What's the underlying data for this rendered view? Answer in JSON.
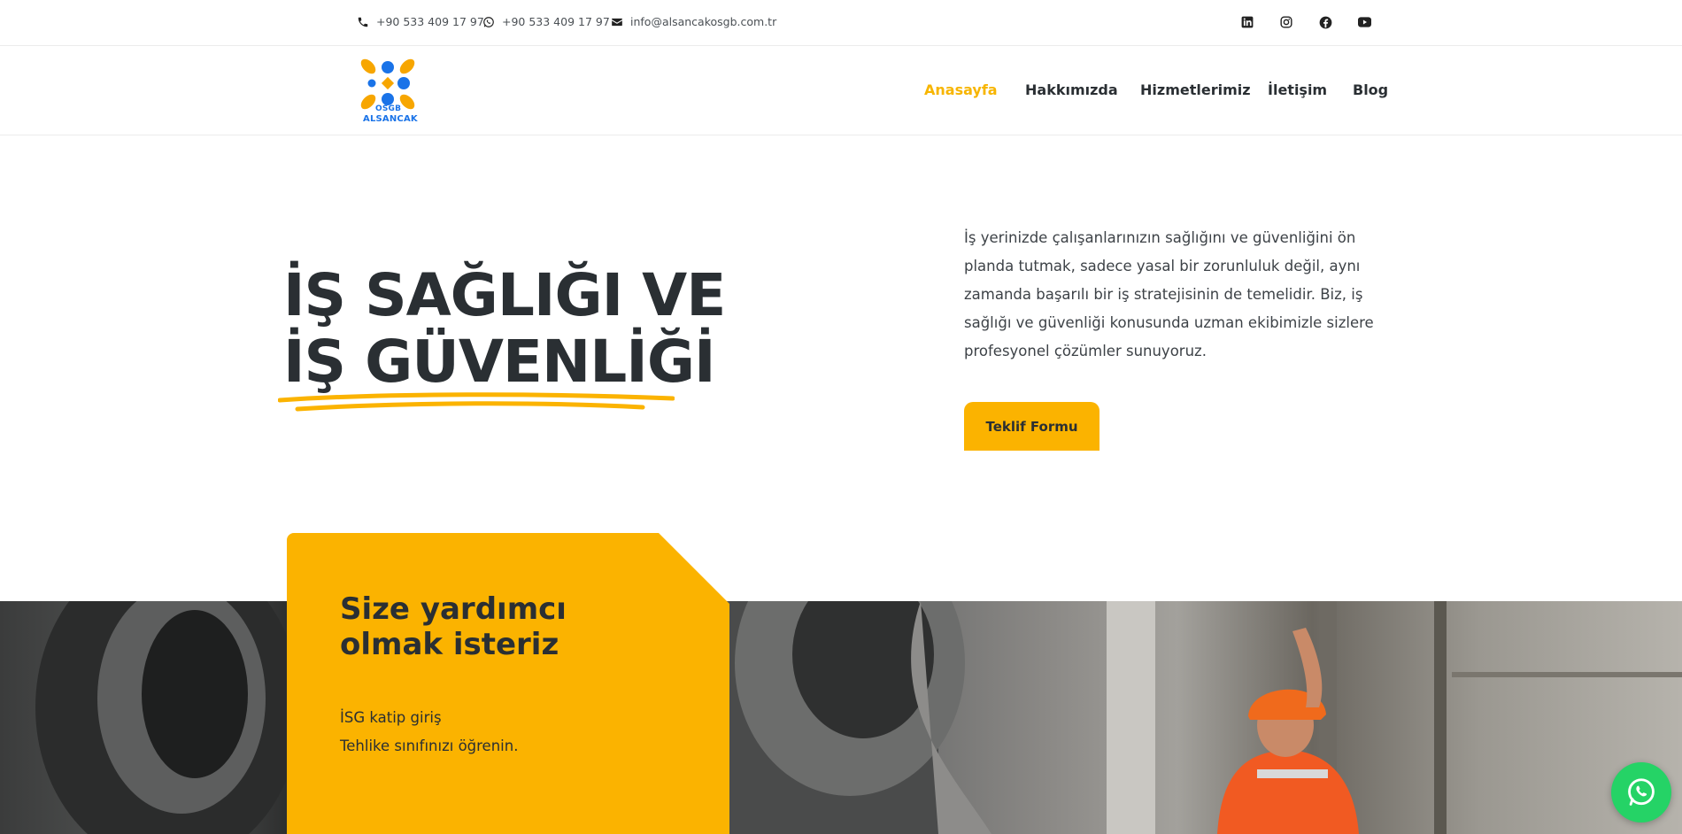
{
  "topbar": {
    "phone": "+90 533 409 17 97",
    "whatsapp": "+90 533 409 17 97",
    "email": "info@alsancakosgb.com.tr",
    "social_icons": [
      "linkedin-icon",
      "instagram-icon",
      "facebook-icon",
      "youtube-icon"
    ]
  },
  "brand": {
    "line1": "OSGB",
    "line2": "ALSANCAK",
    "colors": {
      "orange": "#f7a600",
      "blue": "#1a73e8"
    }
  },
  "nav": {
    "items": [
      {
        "label": "Anasayfa",
        "active": true
      },
      {
        "label": "Hakkımızda",
        "active": false
      },
      {
        "label": "Hizmetlerimiz",
        "active": false
      },
      {
        "label": "İletişim",
        "active": false
      },
      {
        "label": "Blog",
        "active": false
      }
    ]
  },
  "hero": {
    "title_line1": "İŞ SAĞLIĞI VE",
    "title_line2": "İŞ GÜVENLİĞİ",
    "description": "İş yerinizde çalışanlarınızın sağlığını ve güvenliğini ön planda tutmak, sadece yasal bir zorunluluk değil, aynı zamanda başarılı bir iş stratejisinin de temelidir. Biz, iş sağlığı ve güvenliği konusunda uzman ekibimizle sizlere profesyonel çözümler sunuyoruz.",
    "cta_label": "Teklif Formu"
  },
  "help_panel": {
    "title": "Size yardımcı olmak isteriz",
    "links": [
      "İSG katip giriş",
      "Tehlike sınıfınızı öğrenin."
    ]
  },
  "theme": {
    "accent": "#fbb300",
    "text": "#2a2f33",
    "whatsapp": "#25d366"
  }
}
